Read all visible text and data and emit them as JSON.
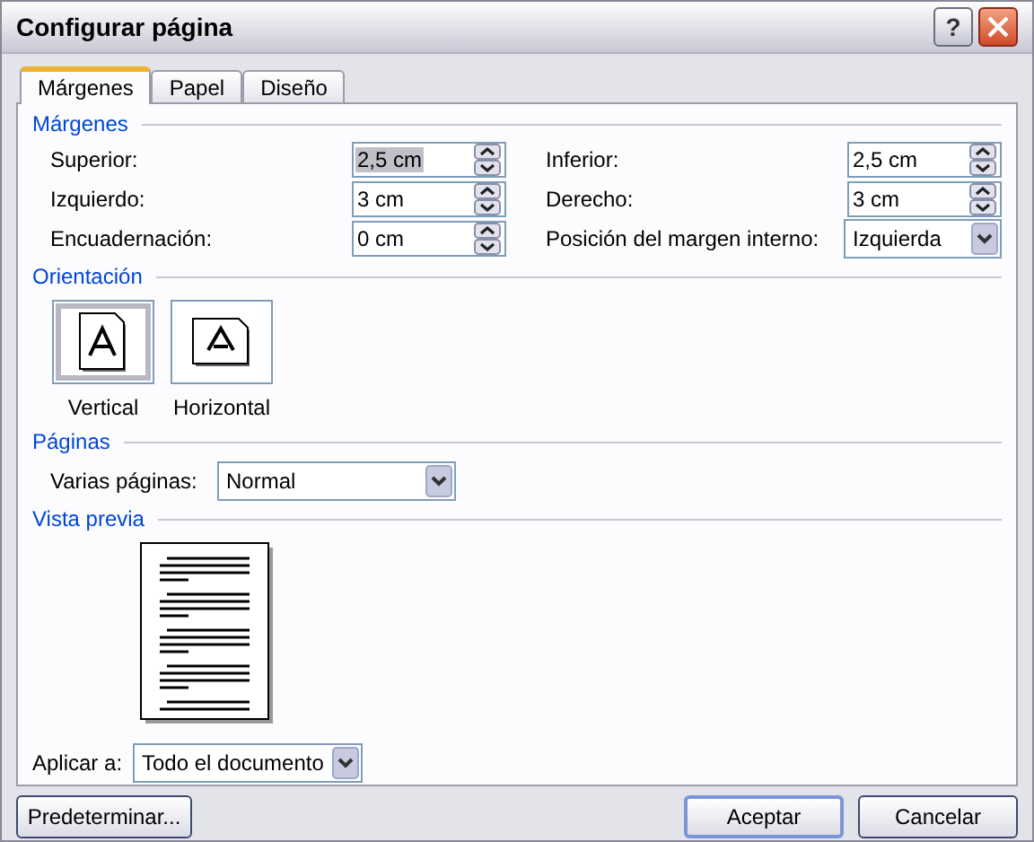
{
  "window": {
    "title": "Configurar página",
    "help": "?"
  },
  "tabs": [
    {
      "label": "Márgenes",
      "selected": true
    },
    {
      "label": "Papel",
      "selected": false
    },
    {
      "label": "Diseño",
      "selected": false
    }
  ],
  "margins": {
    "heading": "Márgenes",
    "fields": [
      {
        "label": "Superior:",
        "value": "2,5 cm",
        "kind": "spin",
        "selected": true
      },
      {
        "label": "Inferior:",
        "value": "2,5 cm",
        "kind": "spin",
        "selected": false
      },
      {
        "label": "Izquierdo:",
        "value": "3 cm",
        "kind": "spin",
        "selected": false
      },
      {
        "label": "Derecho:",
        "value": "3 cm",
        "kind": "spin",
        "selected": false
      },
      {
        "label": "Encuadernación:",
        "value": "0 cm",
        "kind": "spin",
        "selected": false
      },
      {
        "label": "Posición del margen interno:",
        "value": "Izquierda",
        "kind": "dropdown"
      }
    ]
  },
  "orientation": {
    "heading": "Orientación",
    "options": [
      {
        "label": "Vertical",
        "selected": true
      },
      {
        "label": "Horizontal",
        "selected": false
      }
    ]
  },
  "pages": {
    "heading": "Páginas",
    "label": "Varias páginas:",
    "value": "Normal"
  },
  "preview": {
    "heading": "Vista previa"
  },
  "apply": {
    "label": "Aplicar a:",
    "value": "Todo el documento"
  },
  "buttons": [
    {
      "label": "Predeterminar...",
      "kind": "left"
    },
    {
      "label": "Aceptar",
      "kind": "default"
    },
    {
      "label": "Cancelar",
      "kind": "normal"
    }
  ]
}
